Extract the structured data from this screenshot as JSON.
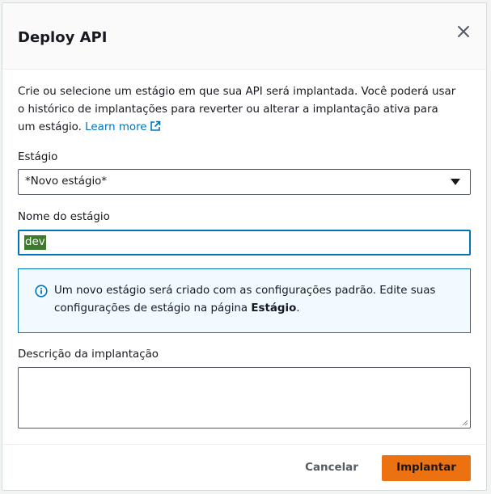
{
  "modal": {
    "title": "Deploy API",
    "close_icon": "close-icon"
  },
  "intro": {
    "text": "Crie ou selecione um estágio em que sua API será implantada. Você poderá usar o histórico de implantações para reverter ou alterar a implantação ativa para um estágio.",
    "link_label": "Learn more",
    "link_icon": "external-link-icon"
  },
  "stage": {
    "label": "Estágio",
    "selected": "*Novo estágio*",
    "caret_icon": "caret-down-icon"
  },
  "stage_name": {
    "label": "Nome do estágio",
    "value": "dev"
  },
  "info": {
    "icon": "info-icon",
    "text_before": "Um novo estágio será criado com as configurações padrão. Edite suas configurações de estágio na página ",
    "text_bold": "Estágio",
    "text_after": "."
  },
  "description": {
    "label": "Descrição da implantação",
    "value": ""
  },
  "footer": {
    "cancel_label": "Cancelar",
    "deploy_label": "Implantar"
  },
  "colors": {
    "link": "#0073bb",
    "primary": "#ec7211",
    "info_bg": "#f1faff",
    "focus": "#0073bb"
  }
}
